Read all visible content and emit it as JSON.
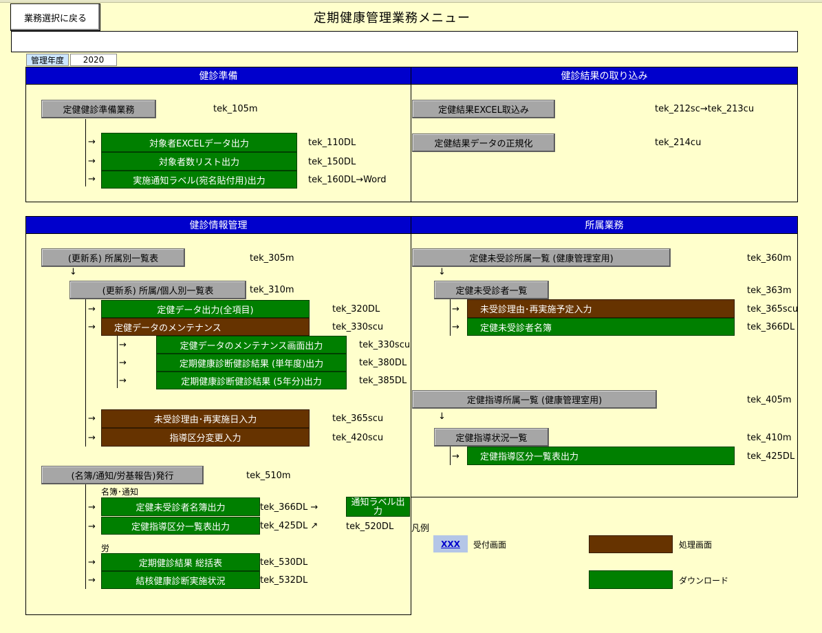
{
  "header": {
    "back_button": "業務選択に戻る",
    "title": "定期健康管理業務メニュー",
    "year_label": "管理年度",
    "year_value": "2020"
  },
  "sections": {
    "prep": "健診準備",
    "import": "健診結果の取り込み",
    "info": "健診情報管理",
    "affil": "所属業務"
  },
  "prep": {
    "main": {
      "label": "定健健診準備業務",
      "code": "tek_105m"
    },
    "items": [
      {
        "label": "対象者EXCELデータ出力",
        "code": "tek_110DL"
      },
      {
        "label": "対象者数リスト出力",
        "code": "tek_150DL"
      },
      {
        "label": "実施通知ラベル(宛名貼付用)出力",
        "code": "tek_160DL→Word"
      }
    ]
  },
  "import": {
    "items": [
      {
        "label": "定健結果EXCEL取込み",
        "code": "tek_212sc→tek_213cu"
      },
      {
        "label": "定健結果データの正規化",
        "code": "tek_214cu"
      }
    ]
  },
  "info": {
    "update1": {
      "label": "(更新系) 所属別一覧表",
      "code": "tek_305m"
    },
    "update2": {
      "label": "(更新系) 所属/個人別一覧表",
      "code": "tek_310m"
    },
    "out_all": {
      "label": "定健データ出力(全項目)",
      "code": "tek_320DL"
    },
    "maint": {
      "label": "定健データのメンテナンス",
      "code": "tek_330scu"
    },
    "sub": [
      {
        "label": "定健データのメンテナンス画面出力",
        "code": "tek_330scu"
      },
      {
        "label": "定期健康診断健診結果 (単年度)出力",
        "code": "tek_380DL"
      },
      {
        "label": "定期健康診断健診結果 (5年分)出力",
        "code": "tek_385DL"
      }
    ],
    "unexam": {
      "label": "未受診理由･再実施日入力",
      "code": "tek_365scu"
    },
    "guide": {
      "label": "指導区分変更入力",
      "code": "tek_420scu"
    },
    "issue": {
      "label": "(名簿/通知/労基報告)発行",
      "code": "tek_510m"
    },
    "meibo_label": "名簿･通知",
    "meibo": [
      {
        "label": "定健未受診者名簿出力",
        "code": "tek_366DL →"
      },
      {
        "label": "定健指導区分一覧表出力",
        "code": "tek_425DL ↗"
      }
    ],
    "label_btn": "通知ラベル出力",
    "label_code": "tek_520DL",
    "rou_label": "労",
    "rou": [
      {
        "label": "定期健診結果  総括表",
        "code": "tek_530DL"
      },
      {
        "label": "結核健康診断実施状況",
        "code": "tek_532DL"
      }
    ]
  },
  "affil": {
    "unexam_list": {
      "label": "定健未受診所属一覧   (健康管理室用)",
      "code": "tek_360m"
    },
    "unexam_person": {
      "label": "定健未受診者一覧",
      "code": "tek_363m"
    },
    "unexam_reason": {
      "label": "未受診理由･再実施予定入力",
      "code": "tek_365scu"
    },
    "unexam_meibo": {
      "label": "定健未受診者名簿",
      "code": "tek_366DL"
    },
    "guide_list": {
      "label": "定健指導所属一覧   (健康管理室用)",
      "code": "tek_405m"
    },
    "guide_status": {
      "label": "定健指導状況一覧",
      "code": "tek_410m"
    },
    "guide_out": {
      "label": "定健指導区分一覧表出力",
      "code": "tek_425DL"
    }
  },
  "legend": {
    "title": "凡例",
    "link_text": "XXX",
    "reception": "受付画面",
    "process": "処理画面",
    "download": "ダウンロード"
  },
  "glyphs": {
    "arrow_right": "→",
    "arrow_down": "↓"
  },
  "colors": {
    "panel_header": "#0000cc",
    "download": "#007f00",
    "process": "#663300",
    "reception": "#a6a6a6",
    "background": "#ffffcc"
  }
}
